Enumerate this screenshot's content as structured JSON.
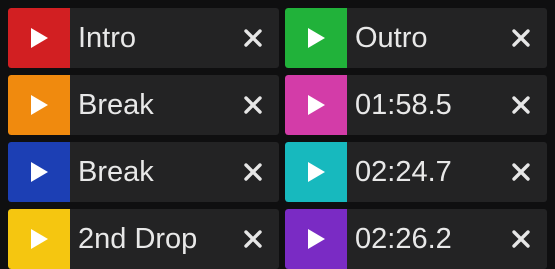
{
  "cues": [
    {
      "label": "Intro",
      "color": "#d21f22"
    },
    {
      "label": "Outro",
      "color": "#21b23a"
    },
    {
      "label": "Break",
      "color": "#f08a0e"
    },
    {
      "label": "01:58.5",
      "color": "#d33ca8"
    },
    {
      "label": "Break",
      "color": "#1c3fb4"
    },
    {
      "label": "02:24.7",
      "color": "#17b9be"
    },
    {
      "label": "2nd Drop",
      "color": "#f5c610"
    },
    {
      "label": "02:26.2",
      "color": "#7a2bc4"
    }
  ],
  "icons": {
    "play": "play-icon",
    "delete": "close-icon"
  }
}
